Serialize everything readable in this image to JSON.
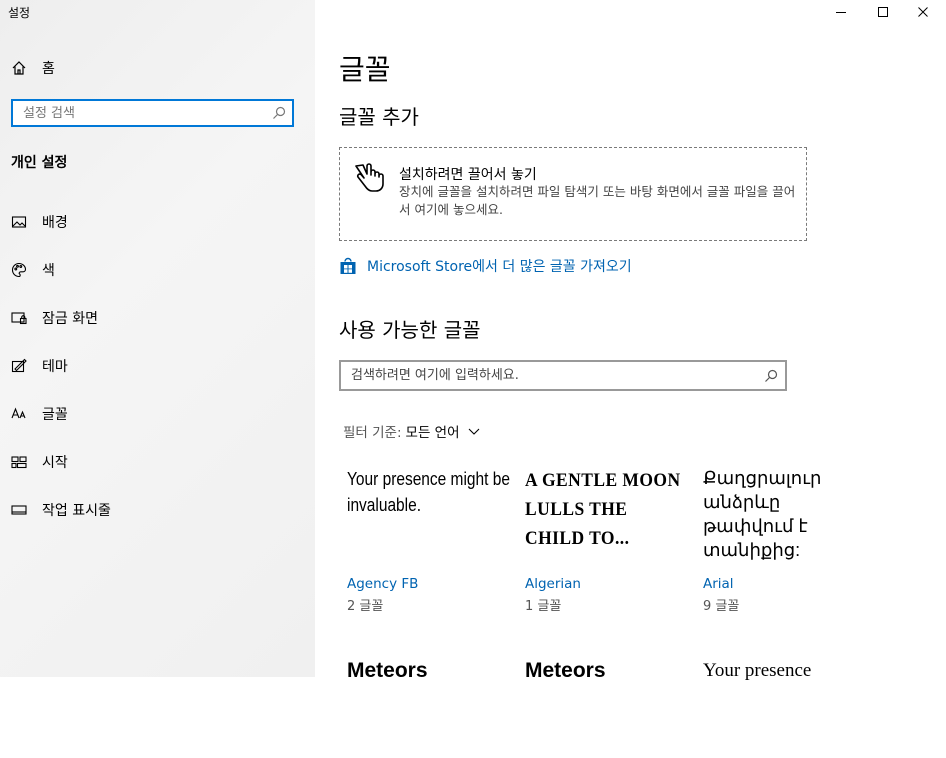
{
  "window": {
    "title": "설정",
    "controls": {
      "minimize": "minimize",
      "maximize": "maximize",
      "close": "close"
    }
  },
  "sidebar": {
    "home_label": "홈",
    "search_placeholder": "설정 검색",
    "section_heading": "개인 설정",
    "items": [
      {
        "label": "배경",
        "icon": "picture-icon"
      },
      {
        "label": "색",
        "icon": "palette-icon"
      },
      {
        "label": "잠금 화면",
        "icon": "lock-screen-icon"
      },
      {
        "label": "테마",
        "icon": "theme-icon"
      },
      {
        "label": "글꼴",
        "icon": "font-icon"
      },
      {
        "label": "시작",
        "icon": "start-icon"
      },
      {
        "label": "작업 표시줄",
        "icon": "taskbar-icon"
      }
    ]
  },
  "main": {
    "title": "글꼴",
    "add_fonts_heading": "글꼴 추가",
    "drop_zone": {
      "title": "설치하려면 끌어서 놓기",
      "description": "장치에 글꼴을 설치하려면 파일 탐색기 또는 바탕 화면에서 글꼴 파일을 끌어서 여기에 놓으세요."
    },
    "store_link": "Microsoft Store에서 더 많은 글꼴 가져오기",
    "available_heading": "사용 가능한 글꼴",
    "font_search_placeholder": "검색하려면 여기에 입력하세요.",
    "filter": {
      "label": "필터 기준:",
      "value": "모든 언어"
    },
    "fonts": [
      {
        "preview": "Your presence might be invaluable.",
        "name": "Agency FB",
        "count": "2 글꼴"
      },
      {
        "preview": "A gentle moon lulls the child to...",
        "name": "Algerian",
        "count": "1 글꼴"
      },
      {
        "preview": "Քաղցրալուր անձրևը թափվում է տանիքից:",
        "name": "Arial",
        "count": "9 글꼴"
      },
      {
        "preview": "Meteors"
      },
      {
        "preview": "Meteors"
      },
      {
        "preview": "Your presence"
      }
    ]
  },
  "colors": {
    "accent": "#0078d7",
    "link": "#0063b1",
    "sidebar_bg": "#f2f2f2"
  }
}
